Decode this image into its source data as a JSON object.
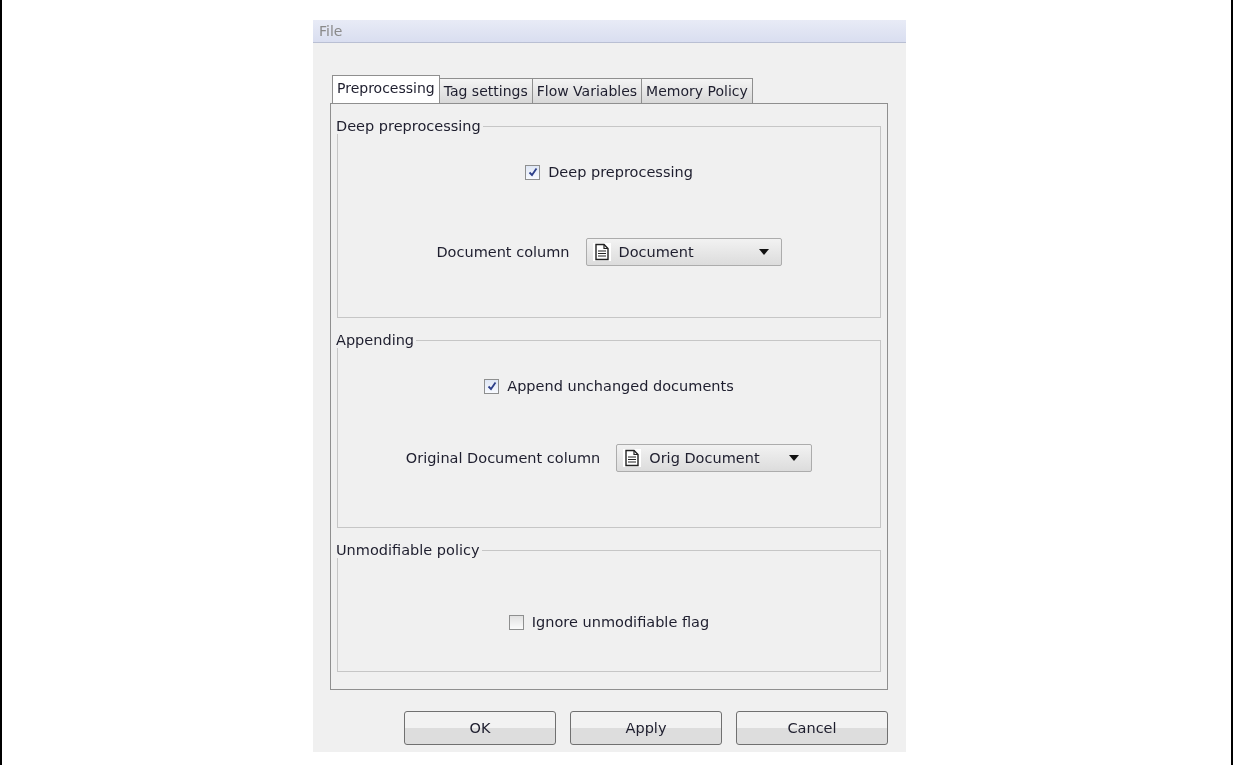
{
  "window": {
    "menu": [
      {
        "label": "File",
        "disabled": true
      }
    ]
  },
  "tabs": [
    {
      "label": "Preprocessing",
      "selected": true
    },
    {
      "label": "Tag settings",
      "selected": false
    },
    {
      "label": "Flow Variables",
      "selected": false
    },
    {
      "label": "Memory Policy",
      "selected": false
    }
  ],
  "groups": [
    {
      "title": "Deep preprocessing",
      "items": [
        {
          "kind": "checkbox",
          "label": "Deep preprocessing",
          "checked": true
        },
        {
          "kind": "dropdown",
          "label": "Document column",
          "value": "Document"
        }
      ]
    },
    {
      "title": "Appending",
      "items": [
        {
          "kind": "checkbox",
          "label": "Append unchanged documents",
          "checked": true
        },
        {
          "kind": "dropdown",
          "label": "Original Document column",
          "value": "Orig Document"
        }
      ]
    },
    {
      "title": "Unmodifiable policy",
      "items": [
        {
          "kind": "checkbox",
          "label": "Ignore unmodifiable flag",
          "checked": false
        }
      ]
    }
  ],
  "buttons": [
    "OK",
    "Apply",
    "Cancel"
  ]
}
